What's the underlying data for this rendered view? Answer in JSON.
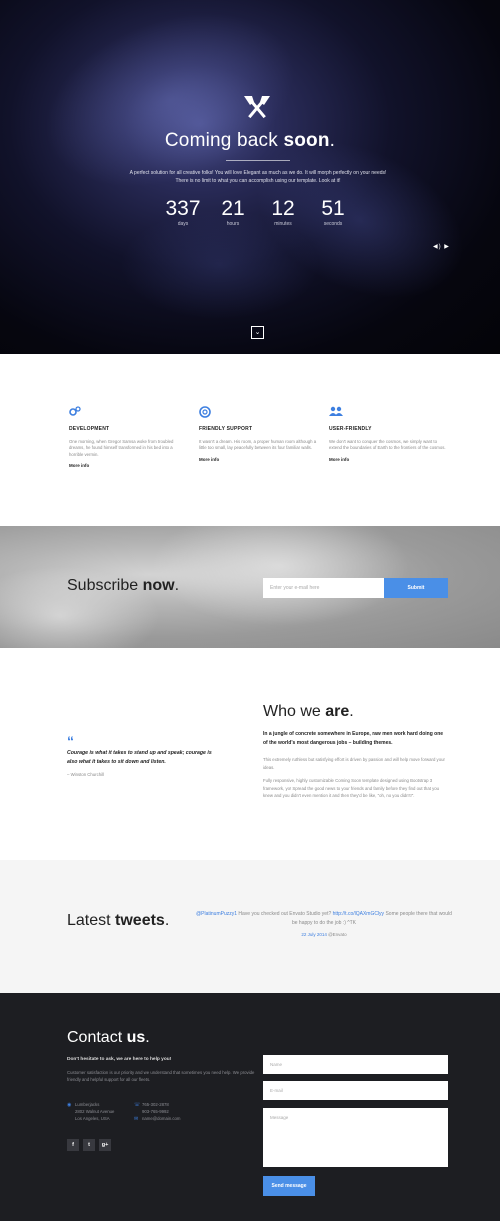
{
  "hero": {
    "title_light": "Coming back ",
    "title_bold": "soon",
    "title_end": ".",
    "text": "A perfect solution for all creative folks! You will love Elegant as much as we do. It will morph perfectly on your needs! There is no limit to what you can accomplish using our template. Look at it!",
    "countdown": [
      {
        "value": "337",
        "label": "days"
      },
      {
        "value": "21",
        "label": "hours"
      },
      {
        "value": "12",
        "label": "minutes"
      },
      {
        "value": "51",
        "label": "seconds"
      }
    ],
    "audio_controls": "◀) ▶",
    "scroll_icon": "chevron-down"
  },
  "features": [
    {
      "icon": "gears-icon",
      "title": "DEVELOPMENT",
      "text": "One morning, when Gregor Samsa woke from troubled dreams, he found himself transformed in his bed into a horrible vermin.",
      "more": "More info"
    },
    {
      "icon": "lifebuoy-icon",
      "title": "FRIENDLY SUPPORT",
      "text": "It wasn't a dream. His room, a proper human room although a little too small, lay peacefully between its four familiar walls.",
      "more": "More info"
    },
    {
      "icon": "users-icon",
      "title": "USER-FRIENDLY",
      "text": "We don't want to conquer the cosmos, we simply want to extend the boundaries of Earth to the frontiers of the cosmos.",
      "more": "More info"
    }
  ],
  "subscribe": {
    "title_light": "Subscribe ",
    "title_bold": "now",
    "title_end": ".",
    "placeholder": "Enter your e-mail here",
    "button": "Submit"
  },
  "quote": {
    "text": "Courage is what it takes to stand up and speak; courage is also what it takes to sit down and listen.",
    "author": "– Winston Churchill"
  },
  "who": {
    "title_light": "Who we ",
    "title_bold": "are",
    "title_end": ".",
    "lead": "In a jungle of concrete somewhere in Europe, raw men work hard doing one of the world's most dangerous jobs – building themes.",
    "p1": "This extremely ruthless but satisfying effort is driven by passion and will help move forward your ideas.",
    "p2": "Fully responsive, highly customizable Coming Soon template designed using Bootstrap 3 framework, yo! Spread the good news to your friends and family before they find out that you knew and you didn't even mention it and then they'd be like, \"oh, no you didn't!\"."
  },
  "tweets": {
    "title_light": "Latest ",
    "title_bold": "tweets",
    "title_end": ".",
    "handle": "@PlatinumPuzzy1",
    "body": " Have you checked out Envato Studio yet? ",
    "link": "http://t.co/lQAXmGClyy",
    "tail": " Some people there that would be happy to do the job :) ^TK",
    "date": "22 July 2014",
    "by": " @Envato"
  },
  "contact": {
    "title_light": "Contact ",
    "title_bold": "us",
    "title_end": ".",
    "lead": "Don't hesitate to ask, we are here to help you!",
    "text": "Customer satisfaction is our priority and we understand that sometimes you need help. We provide friendly and helpful support for all our fleets.",
    "address": [
      "Lumberjacks",
      "2802 Walnut Avenue",
      "Los Angeles, USA"
    ],
    "phones": [
      "765-302-2878",
      "903-765-9992"
    ],
    "email": "name@domain.com",
    "social": [
      "f",
      "t",
      "g+"
    ],
    "name_placeholder": "Name",
    "email_placeholder": "E-mail",
    "message_placeholder": "Message",
    "send": "Send message"
  }
}
